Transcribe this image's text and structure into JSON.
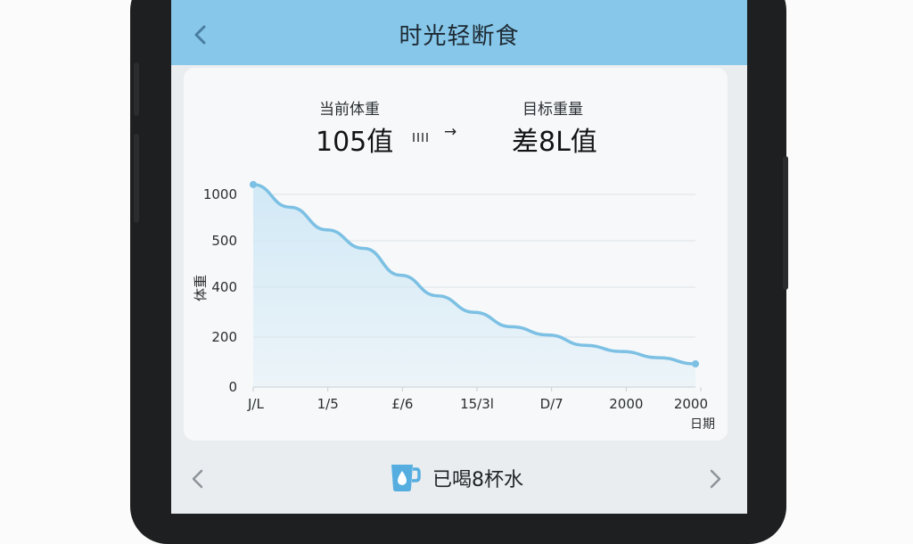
{
  "header": {
    "title": "时光轻断食"
  },
  "weights": {
    "current_label": "当前体重",
    "current_value": "105值",
    "target_label": "目标重量",
    "target_value": "差8L值"
  },
  "chart_data": {
    "type": "area",
    "y_ticks": [
      "1000",
      "500",
      "400",
      "200",
      "0"
    ],
    "x_ticks": [
      "J/L",
      "1/5",
      "£/6",
      "15/3l",
      "D/7",
      "2000",
      "2000"
    ],
    "ylabel": "体重",
    "xlabel": "日期",
    "y_scale": "categorical-ticks",
    "values": [
      870,
      760,
      650,
      560,
      430,
      330,
      250,
      180,
      140,
      90,
      60,
      30,
      0
    ],
    "line_color": "#7cc0e4",
    "fill_color": "#cfe8f6",
    "grid": true
  },
  "bottom": {
    "water_text": "已喝8杯水"
  },
  "colors": {
    "header": "#86c7ea",
    "accent": "#4aa8dd"
  }
}
